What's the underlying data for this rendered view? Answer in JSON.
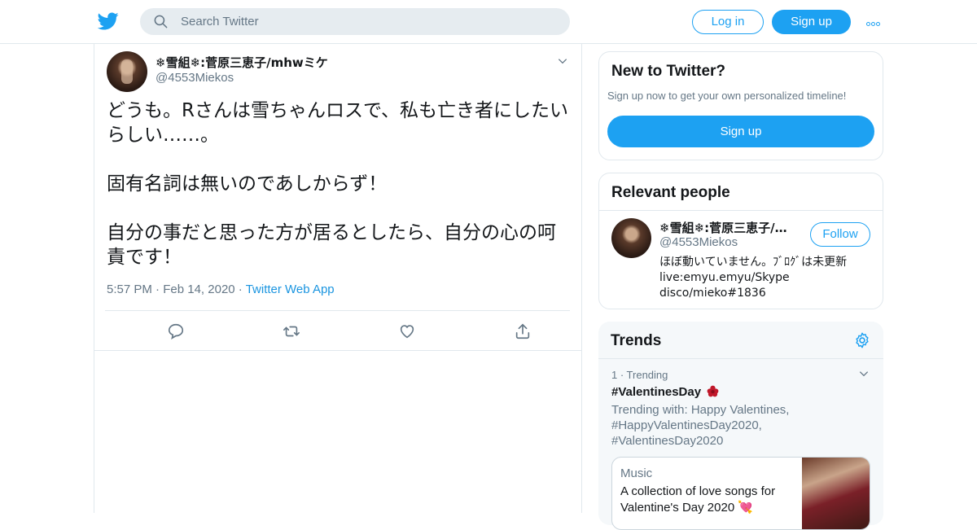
{
  "header": {
    "search_placeholder": "Search Twitter",
    "login_label": "Log in",
    "signup_label": "Sign up",
    "brand_color": "#1da1f2"
  },
  "tweet": {
    "display_name": "❄雪組❄:菅原三恵子/mhwミケ",
    "handle": "@4553Miekos",
    "paragraphs": [
      "どうも。Rさんは雪ちゃんロスで、私も亡き者にしたいらしい……。",
      "固有名詞は無いのであしからず！",
      "自分の事だと思った方が居るとしたら、自分の心の呵責です！"
    ],
    "time": "5:57 PM",
    "date": "Feb 14, 2020",
    "source": "Twitter Web App",
    "separator": "·"
  },
  "sidebar": {
    "new_to_twitter": {
      "title": "New to Twitter?",
      "subtitle": "Sign up now to get your own personalized timeline!",
      "button": "Sign up"
    },
    "relevant_people": {
      "title": "Relevant people",
      "name": "❄雪組❄:菅原三恵子/…",
      "handle": "@4553Miekos",
      "follow_label": "Follow",
      "bio_lines": [
        "ほぼ動いていません。ﾌﾞﾛｸﾞは未更新",
        "live:emyu.emyu/Skype",
        "disco/mieko#1836"
      ]
    },
    "trends": {
      "title": "Trends",
      "rank_line": "1 · Trending",
      "hashtag": "#ValentinesDay",
      "trending_with": "Trending with: Happy Valentines, #HappyValentinesDay2020, #ValentinesDay2020",
      "media_category": "Music",
      "media_desc": "A collection of love songs for Valentine's Day 2020 💘"
    }
  }
}
